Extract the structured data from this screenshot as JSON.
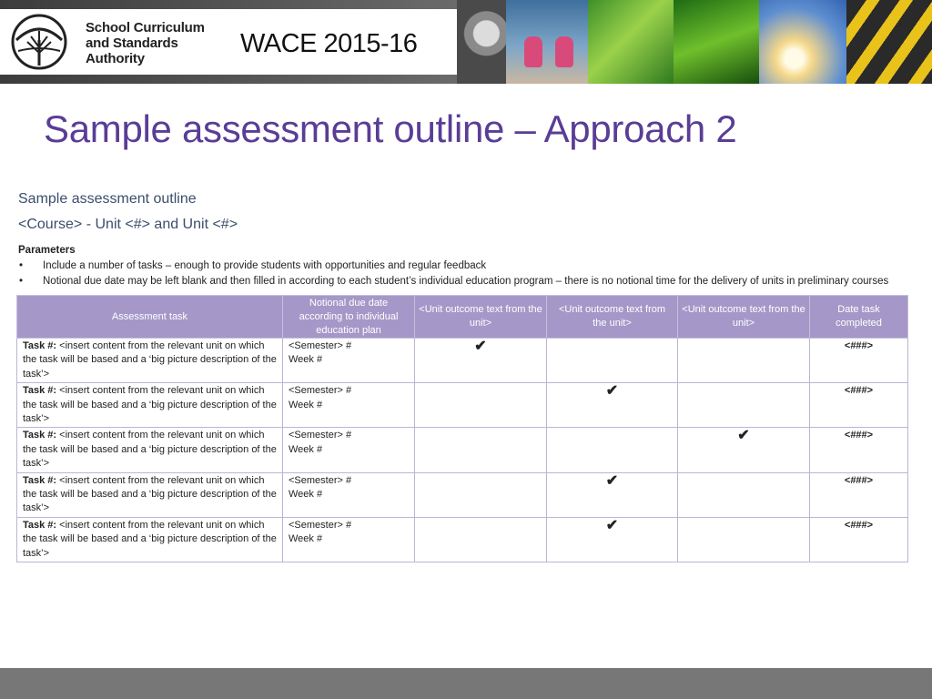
{
  "banner": {
    "org_line1": "School Curriculum",
    "org_line2": "and Standards",
    "org_line3": "Authority",
    "wace_label": "WACE 2015-16",
    "logo_icon": "tree-logo-icon"
  },
  "slide": {
    "title": "Sample assessment outline – Approach 2"
  },
  "document": {
    "title": "Sample assessment outline",
    "subtitle": "<Course> - Unit <#> and Unit <#>",
    "parameters_heading": "Parameters",
    "bullet_glyph": "•",
    "bullets": [
      "Include a number of tasks – enough to provide students with opportunities and regular feedback",
      "Notional due date may be left blank and then filled in according to each student’s individual education program – there is no notional time for the delivery of units in preliminary courses"
    ]
  },
  "table": {
    "headers": [
      "Assessment task",
      "Notional due date according to individual education plan",
      "<Unit outcome text from the unit>",
      "<Unit outcome text from the unit>",
      "<Unit outcome text from the unit>",
      "Date task completed"
    ],
    "check_glyph": "✔",
    "rows": [
      {
        "task_label": "Task #:",
        "task_text": " <insert content from the relevant unit on which the task will be based and a ‘big picture description of the task’>",
        "semester": "<Semester> #",
        "week": "Week #",
        "outcome_checks": [
          true,
          false,
          false
        ],
        "completed": "<###>"
      },
      {
        "task_label": "Task #:",
        "task_text": " <insert content from the relevant unit on which the task will be based and a ‘big picture description of the task’>",
        "semester": "<Semester> #",
        "week": "Week #",
        "outcome_checks": [
          false,
          true,
          false
        ],
        "completed": "<###>"
      },
      {
        "task_label": "Task #:",
        "task_text": " <insert content from the relevant unit on which the task will be based and a ‘big picture description of the task’>",
        "semester": "<Semester> #",
        "week": "Week #",
        "outcome_checks": [
          false,
          false,
          true
        ],
        "completed": "<###>"
      },
      {
        "task_label": "Task #:",
        "task_text": " <insert content from the relevant unit on which the task will be based and a ‘big picture description of the task’>",
        "semester": "<Semester> #",
        "week": "Week #",
        "outcome_checks": [
          false,
          true,
          false
        ],
        "completed": "<###>"
      },
      {
        "task_label": "Task #:",
        "task_text": " <insert content from the relevant unit on which the task will be based and a ‘big picture description of the task’>",
        "semester": "<Semester> #",
        "week": "Week #",
        "outcome_checks": [
          false,
          true,
          false
        ],
        "completed": "<###>"
      }
    ]
  },
  "colors": {
    "title": "#5a3d96",
    "table_header": "#a598c8",
    "footer": "#777777"
  }
}
